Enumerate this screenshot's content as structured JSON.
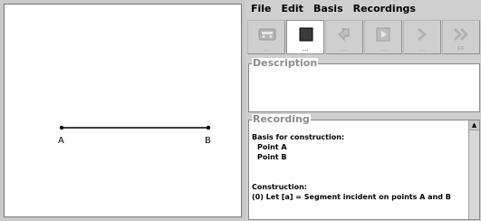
{
  "canvas": {
    "point_a_label": "A",
    "point_b_label": "B",
    "segment_color": "#000000"
  },
  "menu": {
    "items": [
      "File",
      "Edit",
      "Basis",
      "Recordings"
    ]
  },
  "toolbar": {
    "buttons": [
      {
        "icon": "rewind-tape-icon",
        "caption": "...",
        "state": "disabled"
      },
      {
        "icon": "stop-icon",
        "caption": "...",
        "state": "active"
      },
      {
        "icon": "undo-step-icon",
        "caption": "...",
        "state": "disabled"
      },
      {
        "icon": "play-step-icon",
        "caption": "...",
        "state": "disabled"
      },
      {
        "icon": "next-icon",
        "caption": "...",
        "state": "disabled"
      },
      {
        "icon": "fast-forward-icon",
        "caption": "FF",
        "state": "disabled"
      }
    ]
  },
  "description": {
    "title": "Description",
    "text": ""
  },
  "recording": {
    "title": "Recording",
    "basis_heading": "Basis for construction:",
    "basis_items": [
      "Point A",
      "Point B"
    ],
    "construction_heading": "Construction:",
    "construction_steps": [
      "(0)  Let [a] = Segment incident on points A and B"
    ]
  }
}
